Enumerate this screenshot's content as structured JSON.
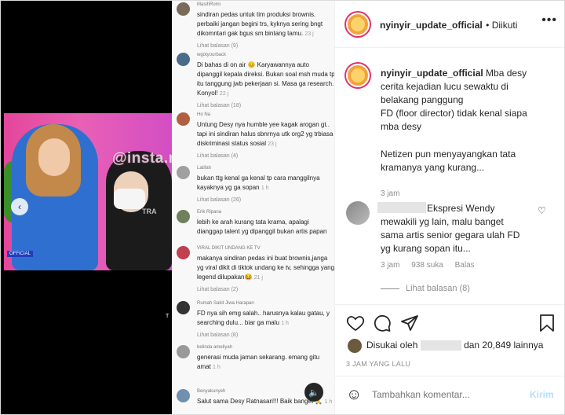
{
  "media": {
    "watermark": "@insta.nyinyir",
    "tag": "OFFICIAL",
    "corner_text": "TRA",
    "tiny_text": "T",
    "comments": [
      {
        "user": "MasihRomi",
        "text": "sindiran pedas untuk tim produksi brownis. perbaiki jangan begini trs, kyknya sering bngt dikomntari gak bgus sm bintang tamu.",
        "time": "23 j",
        "replies": "Lihat balasan (9)"
      },
      {
        "user": "wgotyourback",
        "text": "Di bahas di on air 😊 Karyawannya auto dipanggil kepala direksi. Bukan soal msh muda tp itu tanggung jwb pekerjaan si. Masa ga research. Konyol!",
        "time": "22 j",
        "replies": "Lihat balasan (18)"
      },
      {
        "user": "Ho Na",
        "text": "Untung Desy nya humble yee kagak arogan gt.. tapi ini sindiran halus sbnrnya utk org2 yg trbiasa diskriminasi status sosial",
        "time": "23 j",
        "replies": "Lihat balasan (4)"
      },
      {
        "user": "Latifah",
        "text": "bukan ttg kenal ga kenal tp cara manggilnya kayaknya yg ga sopan",
        "time": "1 h",
        "replies": "Lihat balasan (26)"
      },
      {
        "user": "Erik Ripana",
        "text": "lebih ke arah kurang tata krama, apalagi dianggap talent yg dipanggil bukan artis papan",
        "time": "",
        "replies": ""
      },
      {
        "user": "VIRAL DIKIT UNDANG KE TV",
        "text": "makanya sindiran pedas ini buat brownis,janga yg viral dikit di tiktok undang ke tv, sehingga yang legend dilupakan😂",
        "time": "21 j",
        "replies": "Lihat balasan (2)"
      },
      {
        "user": "Rumah Sakit Jiwa Harapan",
        "text": "FD nya sih emg salah.. harusnya kalau gatau, y searching dulu... biar ga malu",
        "time": "1 h",
        "replies": "Lihat balasan (8)"
      },
      {
        "user": "belinda ameliyah",
        "text": "generasi muda jaman sekarang. emang gitu amat",
        "time": "1 h",
        "replies": ""
      },
      {
        "user": "Benyakunyeh",
        "text": "Salut sama Desy Ratnasari!!! Baik banget 🙏",
        "time": "1 h",
        "replies": ""
      }
    ]
  },
  "post": {
    "username": "nyinyir_update_official",
    "follow_status": "• Diikuti",
    "more_icon": "more-icon",
    "caption_user": "nyinyir_update_official",
    "caption_lines": [
      "Mba desy",
      "cerita kejadian lucu sewaktu di",
      "belakang panggung",
      "FD (floor director) tidak kenal siapa",
      "mba desy"
    ],
    "caption_para2": [
      "Netizen pun menyayangkan tata",
      "kramanya yang kurang..."
    ],
    "caption_time": "3 jam",
    "comment": {
      "user": "",
      "text_lines": [
        "Ekspresi Wendy",
        "mewakili yg lain, malu banget",
        "sama artis senior gegara ulah FD",
        "yg kurang sopan itu..."
      ],
      "time": "3 jam",
      "likes": "938 suka",
      "reply": "Balas",
      "view_replies": "Lihat balasan (8)"
    },
    "likes_prefix": "Disukai oleh",
    "likes_suffix": "dan 20,849 lainnya",
    "date": "3 JAM YANG LALU",
    "add_comment_placeholder": "Tambahkan komentar...",
    "post_button": "Kirim"
  },
  "colors": {
    "accent": "#e1306c",
    "link": "#b2dffc",
    "muted": "#8e8e8e"
  }
}
